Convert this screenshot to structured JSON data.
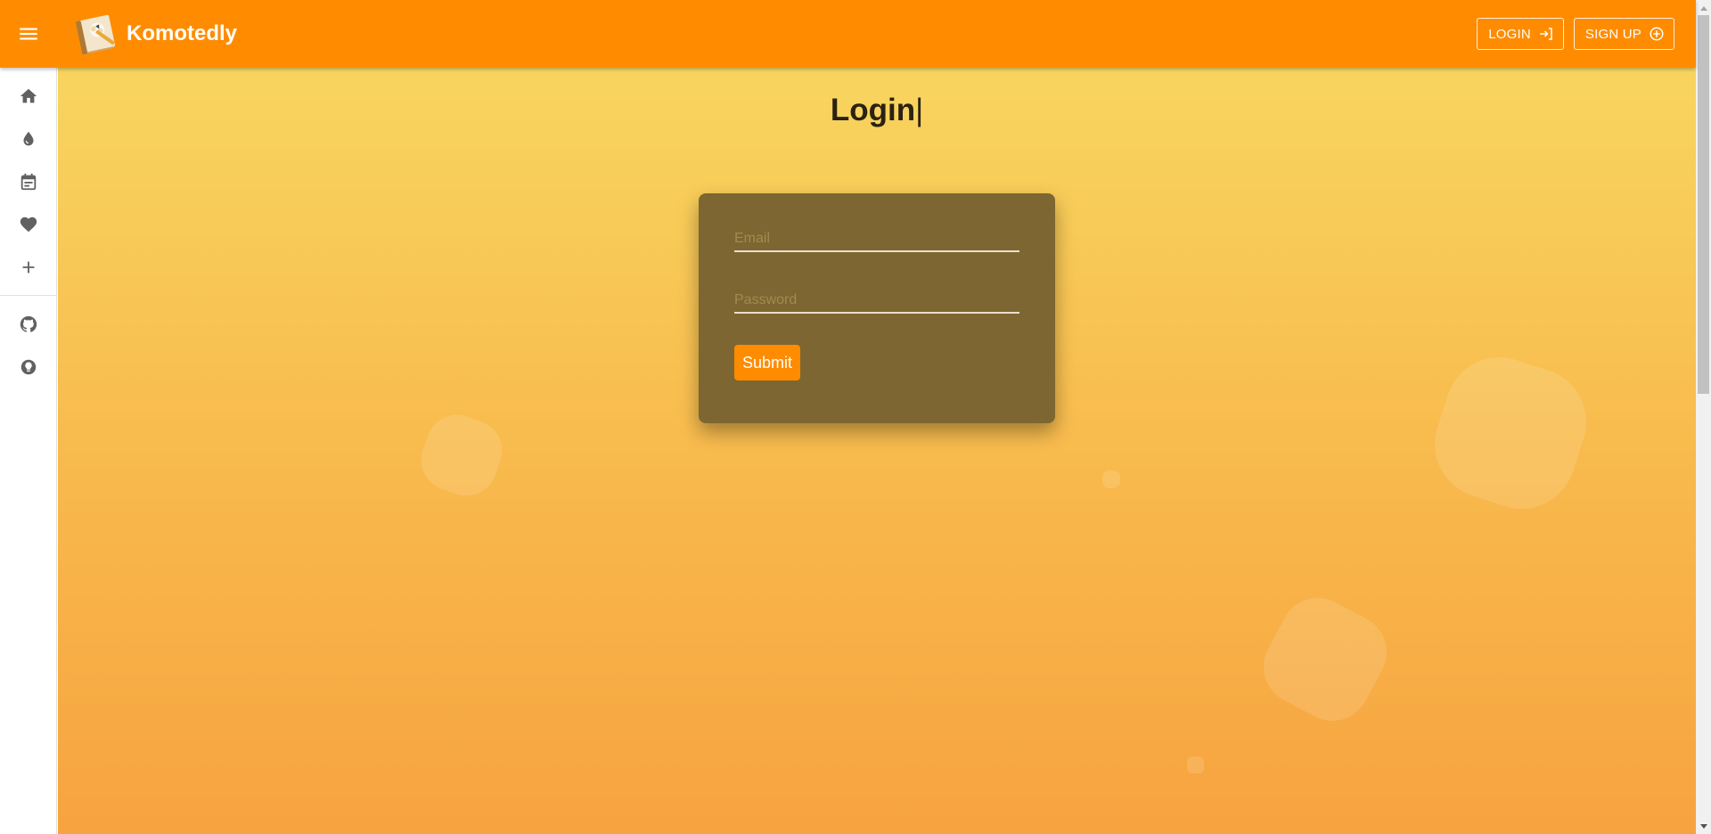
{
  "app": {
    "name": "Komotedly",
    "brand_color": "#ff8c00"
  },
  "header": {
    "menu_icon": "menu-icon",
    "logo_icon": "notebook-logo-icon",
    "login_label": "LOGIN",
    "login_icon": "login-icon",
    "signup_label": "SIGN UP",
    "signup_icon": "add-circle-icon"
  },
  "sidebar": {
    "items": [
      {
        "name": "home",
        "icon": "home-icon"
      },
      {
        "name": "drop",
        "icon": "water-drop-icon"
      },
      {
        "name": "calendar",
        "icon": "calendar-note-icon"
      },
      {
        "name": "favorites",
        "icon": "heart-icon"
      },
      {
        "name": "add",
        "icon": "plus-icon"
      }
    ],
    "secondary_items": [
      {
        "name": "github",
        "icon": "github-icon"
      },
      {
        "name": "theme",
        "icon": "lightbulb-icon"
      }
    ]
  },
  "main": {
    "title": "Login",
    "caret": "|",
    "form": {
      "email_placeholder": "Email",
      "email_value": "",
      "password_placeholder": "Password",
      "password_value": "",
      "submit_label": "Submit"
    },
    "background_colors": [
      "#f8d55f",
      "#f7a340"
    ],
    "card_color": "#7d6631"
  }
}
